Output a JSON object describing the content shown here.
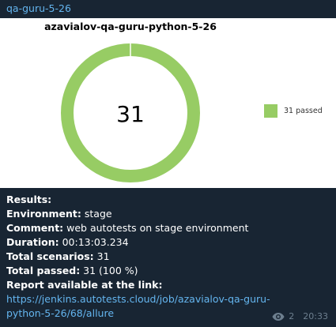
{
  "message": {
    "channel_title": "qa-guru-5-26",
    "chart_data": {
      "type": "pie",
      "title": "azavialov-qa-guru-python-5-26",
      "center_label": "31",
      "slices": [
        {
          "label": "31 passed",
          "value": 31,
          "color": "#97cc64"
        }
      ],
      "legend_position": "right"
    },
    "results": {
      "heading": "Results:",
      "environment_label": "Environment:",
      "environment_value": " stage",
      "comment_label": "Comment:",
      "comment_value": " web autotests on stage environment",
      "duration_label": "Duration:",
      "duration_value": " 00:13:03.234",
      "total_scenarios_label": "Total scenarios:",
      "total_scenarios_value": " 31",
      "total_passed_label": "Total passed:",
      "total_passed_value": " 31 (100 %)",
      "report_label": "Report available at the link:",
      "report_link_line1": "https://jenkins.autotests.cloud/job/azavialov-qa-guru-",
      "report_link_line2": "python-5-26/68/allure"
    },
    "meta": {
      "views_icon": "eye-icon",
      "views": "2",
      "time": "20:33"
    }
  }
}
